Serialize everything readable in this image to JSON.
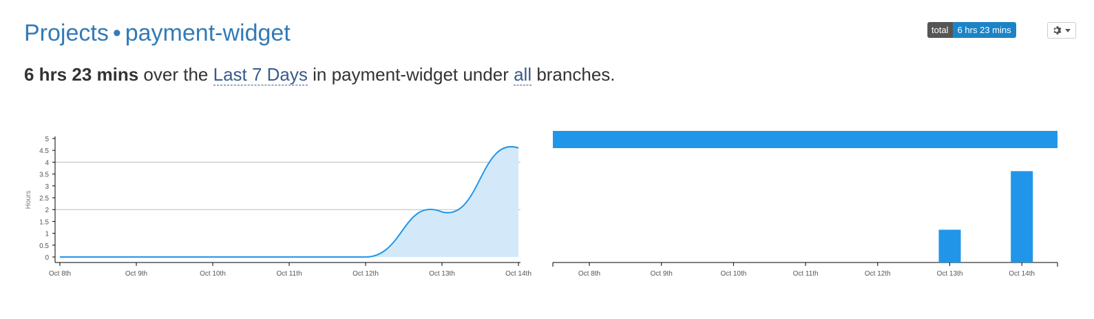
{
  "header": {
    "projects_link": "Projects",
    "separator": "•",
    "project_name": "payment-widget"
  },
  "summary": {
    "total": "6 hrs 23 mins",
    "text1": " over the ",
    "range": "Last 7 Days",
    "text2": " in payment-widget under ",
    "branches": "all",
    "text3": " branches."
  },
  "badge": {
    "label": "total",
    "value": "6 hrs 23 mins"
  },
  "settings": {
    "icon": "gear-icon"
  },
  "colors": {
    "accent": "#2196e8",
    "area_fill": "#d3e9fa",
    "link": "#337ab7",
    "badge_value_bg": "#1c84c6"
  },
  "chart_data": [
    {
      "type": "area",
      "ylabel": "Hours",
      "ylim": [
        0,
        5
      ],
      "yticks": [
        "0",
        "0.5",
        "1",
        "1.5",
        "2",
        "2.5",
        "3",
        "3.5",
        "4",
        "4.5",
        "5"
      ],
      "gridlines": [
        2,
        4
      ],
      "categories": [
        "Oct 8th",
        "Oct 9th",
        "Oct 10th",
        "Oct 11th",
        "Oct 12th",
        "Oct 13th",
        "Oct 14th"
      ],
      "series": [
        {
          "values": [
            0,
            0,
            0,
            0,
            0,
            1.9,
            4.6
          ]
        }
      ]
    },
    {
      "type": "bar",
      "categories": [
        "Oct 8th",
        "Oct 9th",
        "Oct 10th",
        "Oct 11th",
        "Oct 12th",
        "Oct 13th",
        "Oct 14th"
      ],
      "ylim": [
        0,
        5
      ],
      "series": [
        {
          "values": [
            0,
            0,
            0,
            0,
            0,
            1.4,
            3.9
          ]
        }
      ]
    }
  ]
}
